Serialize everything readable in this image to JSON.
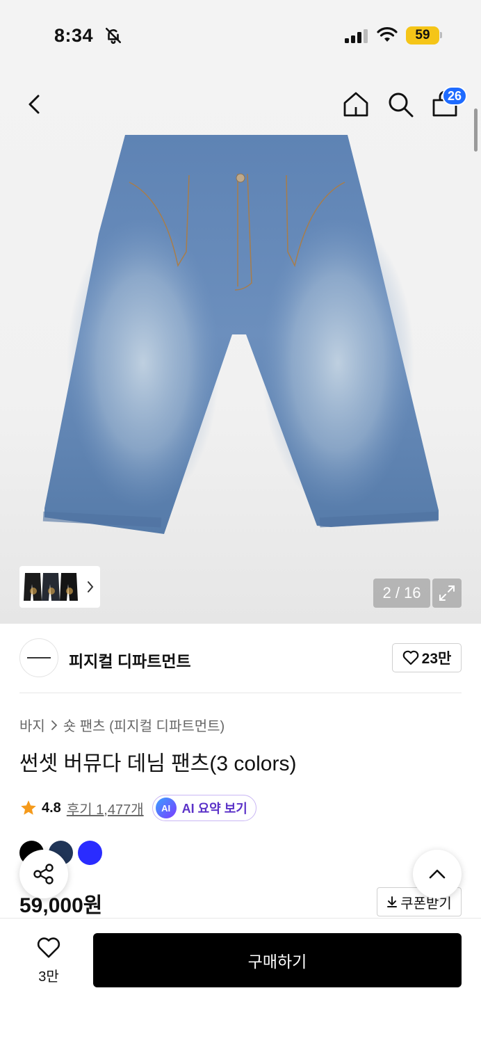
{
  "status_bar": {
    "time": "8:34",
    "battery": "59"
  },
  "header": {
    "cart_count": "26"
  },
  "gallery": {
    "counter": "2 / 16"
  },
  "brand": {
    "name": "피지컬 디파트먼트",
    "likes": "23만"
  },
  "breadcrumb": {
    "category": "바지",
    "subcategory": "숏 팬츠 (피지컬 디파트먼트)"
  },
  "product": {
    "title": "썬셋 버뮤다 데님 팬츠(3 colors)",
    "rating": "4.8",
    "reviews": "후기 1,477개",
    "ai_badge": "AI",
    "ai_summary": "AI 요약 보기",
    "price": "59,000원",
    "coupon": "쿠폰받기",
    "colors": [
      "#000000",
      "#203557",
      "#2a2cff"
    ]
  },
  "bottom_bar": {
    "wish_count": "3만",
    "buy_label": "구매하기"
  },
  "icons": [
    "bell-off-icon",
    "signal-icon",
    "wifi-icon",
    "back-icon",
    "home-icon",
    "search-icon",
    "cart-icon",
    "chevron-right-icon",
    "expand-icon",
    "heart-icon",
    "star-icon",
    "download-icon",
    "share-icon",
    "chevron-up-icon"
  ]
}
